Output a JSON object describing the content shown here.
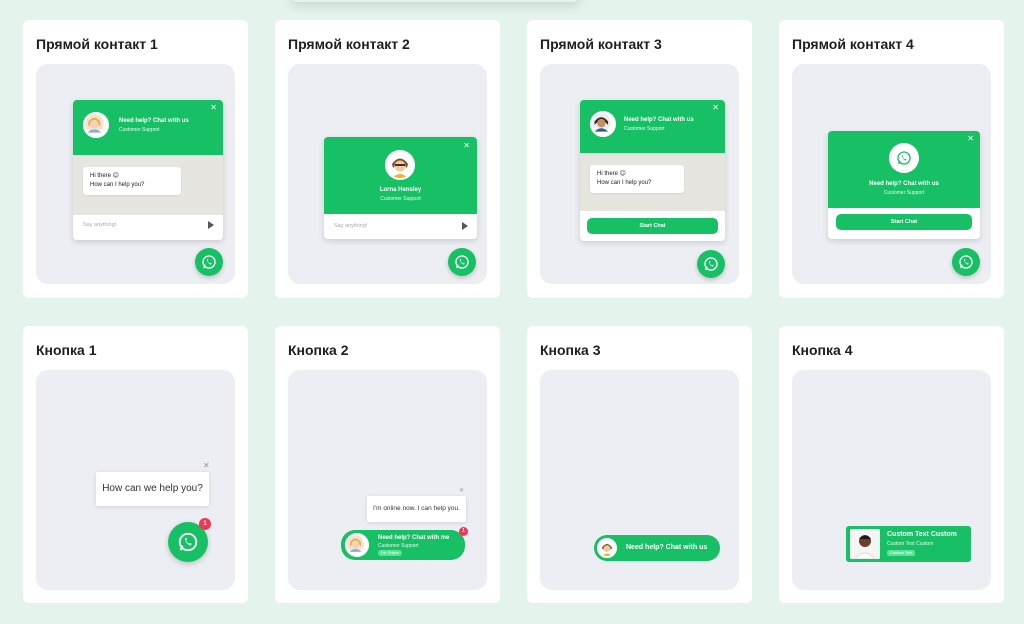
{
  "cards": [
    {
      "title": "Прямой контакт 1"
    },
    {
      "title": "Прямой контакт 2"
    },
    {
      "title": "Прямой контакт 3"
    },
    {
      "title": "Прямой контакт 4"
    },
    {
      "title": "Кнопка 1"
    },
    {
      "title": "Кнопка 2"
    },
    {
      "title": "Кнопка 3"
    },
    {
      "title": "Кнопка 4"
    }
  ],
  "widget1": {
    "title": "Need help? Chat with us",
    "subtitle": "Customer Support",
    "message_line1": "Hi there 😊",
    "message_line2": "How can I help you?",
    "input_placeholder": "Say anything!"
  },
  "widget2": {
    "name": "Lorna Hensley",
    "subtitle": "Customer Support",
    "input_placeholder": "Say anything!"
  },
  "widget3": {
    "title": "Need help? Chat with us",
    "subtitle": "Customer Support",
    "message_line1": "Hi there 😊",
    "message_line2": "How can I help you?",
    "button_label": "Start Chat"
  },
  "widget4": {
    "title": "Need help? Chat with us",
    "subtitle": "Customer Support",
    "button_label": "Start Chat"
  },
  "button1": {
    "bubble_text": "How can we help you?",
    "badge_count": "1"
  },
  "button2": {
    "bubble_text": "I'm online now. I can help you.",
    "badge_count": "1",
    "pill_title": "Need help? Chat with me",
    "pill_subtitle": "Customer Support",
    "status_label": "I'm Online"
  },
  "button3": {
    "pill_title": "Need help? Chat with us"
  },
  "button4": {
    "title": "Custom Text Custom",
    "subtitle": "Custom Text Custom",
    "tag": "Custom Text"
  },
  "colors": {
    "brand_green": "#17c064",
    "badge_red": "#f0365a",
    "background": "#e4f4ec"
  },
  "icons": {
    "whatsapp": "whatsapp-icon",
    "close": "close-icon",
    "send": "send-icon"
  }
}
